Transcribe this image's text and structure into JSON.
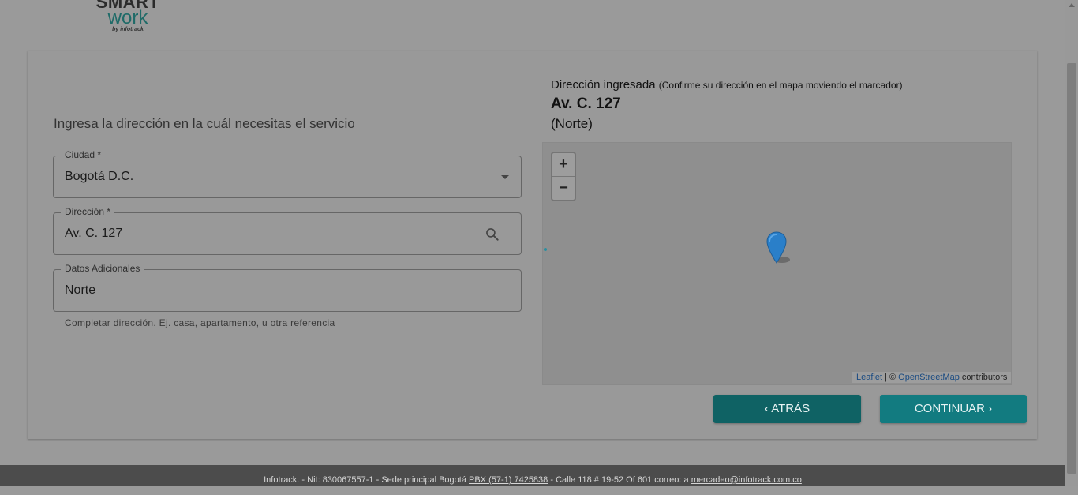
{
  "logo": {
    "line1": "SMART",
    "line2": "work",
    "line3": "by infotrack"
  },
  "form": {
    "prompt": "Ingresa la dirección en la cuál necesitas el servicio",
    "ciudad": {
      "label": "Ciudad *",
      "value": "Bogotá D.C."
    },
    "direccion": {
      "label": "Dirección *",
      "value": "Av. C. 127"
    },
    "datos": {
      "label": "Datos Adicionales",
      "value": "Norte"
    },
    "helper": "Completar dirección. Ej. casa, apartamento, u otra referencia"
  },
  "address_panel": {
    "heading": "Dirección ingresada",
    "confirm": "(Confirme su dirección en el mapa moviendo el marcador)",
    "main": "Av. C. 127",
    "extra": "(Norte)"
  },
  "map": {
    "zoom_in": "+",
    "zoom_out": "−",
    "attribution": {
      "leaflet": "Leaflet",
      "sep": " | © ",
      "osm": "OpenStreetMap",
      "tail": " contributors"
    },
    "marker_color": "#2a7fc9"
  },
  "buttons": {
    "back": "‹ ATRÁS",
    "next": "CONTINUAR ›"
  },
  "footer": {
    "text1": "Infotrack. - Nit: 830067557-1 - Sede principal Bogotá ",
    "phone": "PBX (57-1) 7425838",
    "text2": " - Calle 118 # 19-52 Of 601   correo: a ",
    "email": "mercadeo@infotrack.com.co"
  },
  "colors": {
    "primary": "#127b80",
    "primary_dark": "#0f6264",
    "overlay_bg": "#9a9a9a"
  }
}
